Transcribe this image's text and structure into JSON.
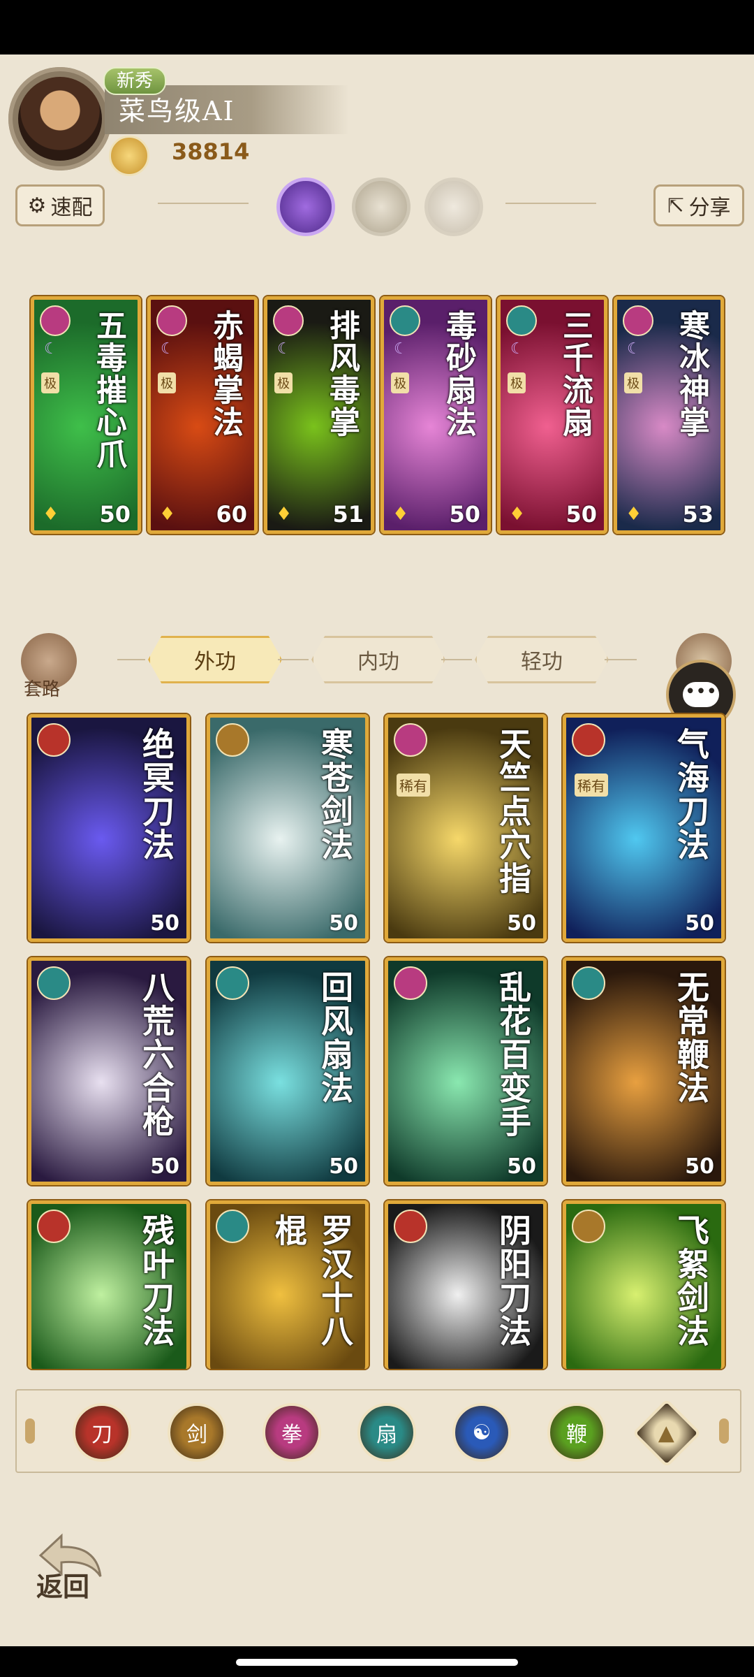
{
  "player": {
    "rank_tag": "新秀",
    "name": "菜鸟级AI",
    "power": "38814"
  },
  "toolbar": {
    "quick_config_label": "速配",
    "share_label": "分享"
  },
  "top_cards": [
    {
      "title": "五毒摧心爪",
      "tag": "极",
      "level": "50",
      "element_color": "#b83b80",
      "art": [
        "#1c6b2a",
        "#3fbf4a"
      ]
    },
    {
      "title": "赤蝎掌法",
      "tag": "极",
      "level": "60",
      "element_color": "#b83b80",
      "art": [
        "#5a1010",
        "#d84b14"
      ]
    },
    {
      "title": "排风毒掌",
      "tag": "极",
      "level": "51",
      "element_color": "#b83b80",
      "art": [
        "#1a1a14",
        "#7ac21c"
      ]
    },
    {
      "title": "毒砂扇法",
      "tag": "极",
      "level": "50",
      "element_color": "#2a8a86",
      "art": [
        "#5a1f6a",
        "#e685d6"
      ]
    },
    {
      "title": "三千流扇",
      "tag": "极",
      "level": "50",
      "element_color": "#2a8a86",
      "art": [
        "#7a1030",
        "#f06090"
      ]
    },
    {
      "title": "寒冰神掌",
      "tag": "极",
      "level": "53",
      "element_color": "#b83b80",
      "art": [
        "#1a2a4a",
        "#d88ac6"
      ]
    }
  ],
  "tabs": {
    "side_left_label": "套路",
    "items": [
      "外功",
      "内功",
      "轻功"
    ],
    "chat_icon": "chat-icon"
  },
  "grid_cards": [
    {
      "title": "绝冥刀法",
      "level": "50",
      "tag": "",
      "element_color": "#b8332a",
      "art": [
        "#1a1640",
        "#6a5af0"
      ]
    },
    {
      "title": "寒苍剑法",
      "level": "50",
      "tag": "",
      "element_color": "#a8782a",
      "art": [
        "#3a6a6a",
        "#e8f2f0"
      ]
    },
    {
      "title": "天竺点穴指",
      "level": "50",
      "tag": "稀有",
      "element_color": "#b83b80",
      "art": [
        "#4a3a10",
        "#f6d86a"
      ]
    },
    {
      "title": "气海刀法",
      "level": "50",
      "tag": "稀有",
      "element_color": "#b8332a",
      "art": [
        "#10205a",
        "#50c8f0"
      ]
    },
    {
      "title": "八荒六合枪",
      "level": "50",
      "tag": "",
      "element_color": "#2a8a86",
      "art": [
        "#2a1a40",
        "#e8e0f0"
      ]
    },
    {
      "title": "回风扇法",
      "level": "50",
      "tag": "",
      "element_color": "#2a8a86",
      "art": [
        "#103a40",
        "#7ae0e0"
      ]
    },
    {
      "title": "乱花百变手",
      "level": "50",
      "tag": "",
      "element_color": "#b83b80",
      "art": [
        "#0f3a2a",
        "#8ae8b0"
      ]
    },
    {
      "title": "无常鞭法",
      "level": "50",
      "tag": "",
      "element_color": "#2a8a86",
      "art": [
        "#2a180c",
        "#e8a040"
      ]
    },
    {
      "title": "残叶刀法",
      "level": "",
      "tag": "",
      "element_color": "#b8332a",
      "art": [
        "#1a5a1a",
        "#bff0a0"
      ]
    },
    {
      "title": "罗汉十八棍",
      "level": "",
      "tag": "",
      "element_color": "#2a8a86",
      "art": [
        "#6a4a10",
        "#f0c040"
      ]
    },
    {
      "title": "阴阳刀法",
      "level": "",
      "tag": "",
      "element_color": "#b8332a",
      "art": [
        "#1a1a1a",
        "#f0f0f0"
      ]
    },
    {
      "title": "飞絮剑法",
      "level": "",
      "tag": "",
      "element_color": "#a8782a",
      "art": [
        "#2a6a10",
        "#d8f070"
      ]
    }
  ],
  "filters": [
    {
      "icon": "blade-icon",
      "color": "#b8332a",
      "glyph": "刀"
    },
    {
      "icon": "sword-icon",
      "color": "#a8782a",
      "glyph": "剑"
    },
    {
      "icon": "fist-icon",
      "color": "#b83b80",
      "glyph": "拳"
    },
    {
      "icon": "fan-icon",
      "color": "#2a8a86",
      "glyph": "扇"
    },
    {
      "icon": "yinyang-icon",
      "color": "#2a5ab8",
      "glyph": "☯"
    },
    {
      "icon": "whip-icon",
      "color": "#5aa020",
      "glyph": "鞭"
    },
    {
      "icon": "collapse-icon",
      "color": "#e8d9b0",
      "glyph": "▲"
    }
  ],
  "back_label": "返回"
}
